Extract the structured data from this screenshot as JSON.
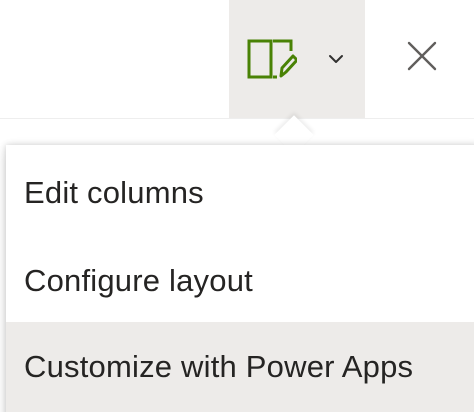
{
  "toolbar": {
    "edit_form_icon": "edit-form-icon",
    "dropdown_icon": "chevron-down-icon",
    "close_icon": "close-icon",
    "accent_color": "#498205"
  },
  "menu": {
    "items": [
      {
        "label": "Edit columns",
        "highlighted": false
      },
      {
        "label": "Configure layout",
        "highlighted": false
      },
      {
        "label": "Customize with Power Apps",
        "highlighted": true
      }
    ]
  }
}
